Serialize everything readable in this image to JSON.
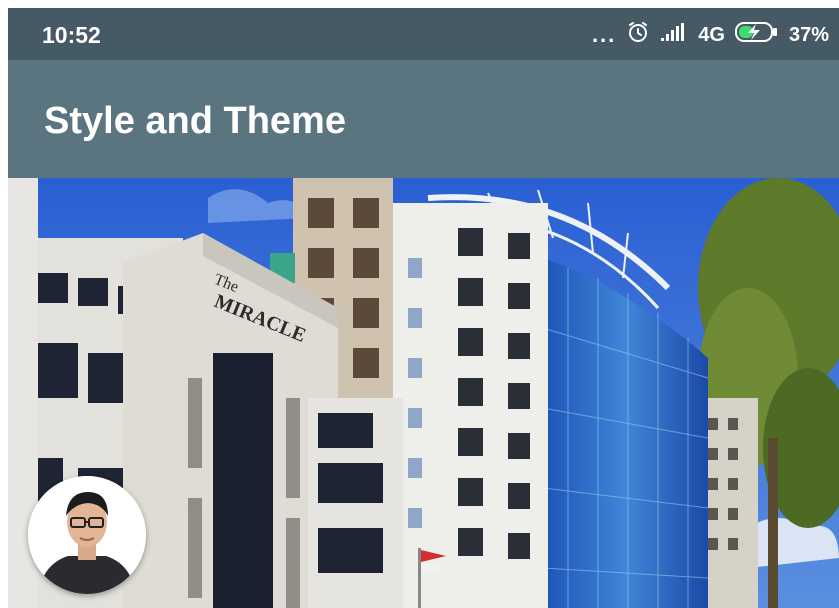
{
  "status_bar": {
    "time": "10:52",
    "network": "4G",
    "battery": "37%",
    "icons": [
      "more-dots-icon",
      "alarm-icon",
      "signal-icon",
      "battery-charging-icon"
    ],
    "background": "#455a64"
  },
  "app_bar": {
    "title": "Style and Theme",
    "background": "#5a7580"
  },
  "hero": {
    "building_sign": "The MIRACLE"
  },
  "avatar": {
    "icon": "profile-avatar"
  }
}
